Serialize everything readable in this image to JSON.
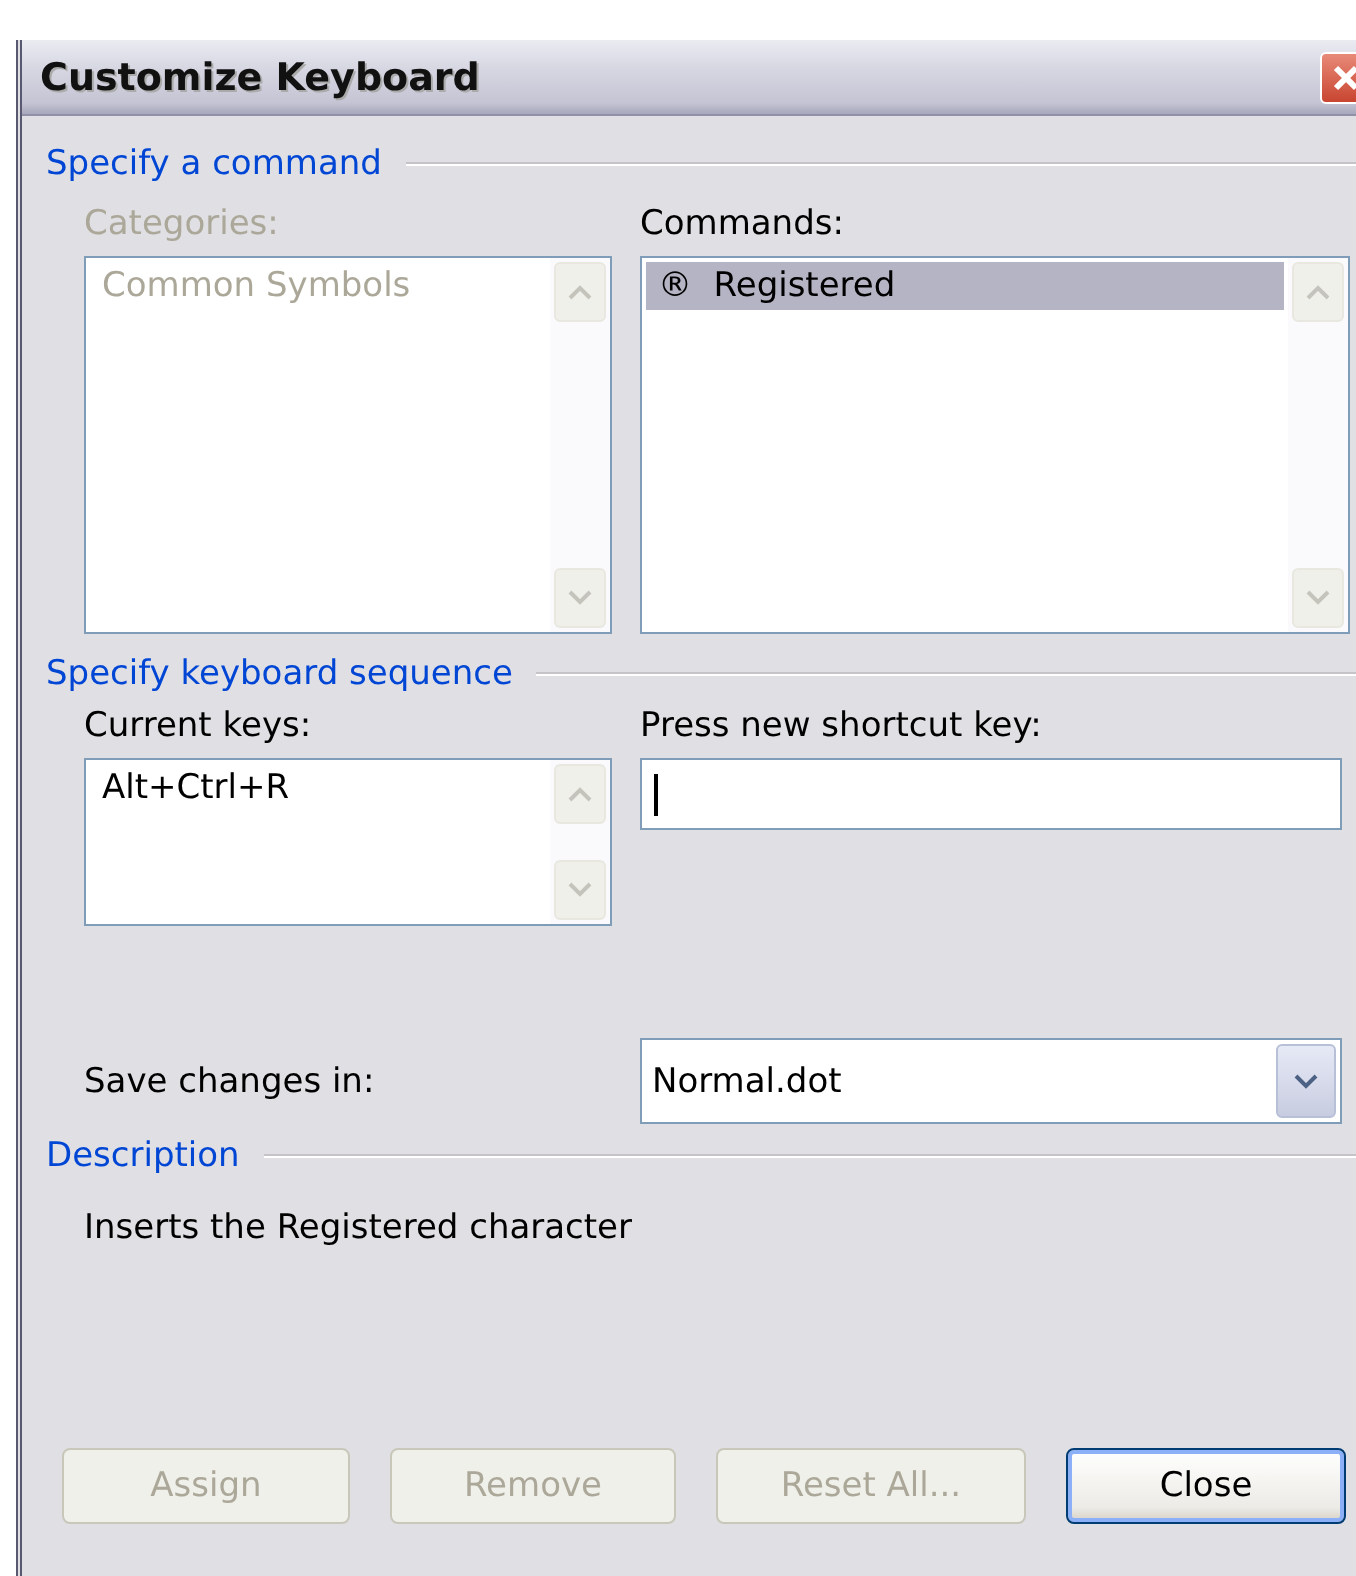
{
  "window": {
    "title": "Customize Keyboard"
  },
  "command_section": {
    "heading": "Specify a command",
    "categories": {
      "label": "Categories:",
      "disabled": true,
      "items": [
        {
          "text": "Common Symbols",
          "selected": false
        }
      ]
    },
    "commands": {
      "label": "Commands:",
      "disabled": false,
      "items": [
        {
          "text": "®  Registered",
          "selected": true
        }
      ]
    }
  },
  "keyboard_section": {
    "heading": "Specify keyboard sequence",
    "current_keys": {
      "label": "Current keys:",
      "disabled": false,
      "items": [
        {
          "text": "Alt+Ctrl+R",
          "selected": false
        }
      ]
    },
    "new_shortcut": {
      "label": "Press new shortcut key:",
      "focused": true
    }
  },
  "save_changes": {
    "label": "Save changes in:",
    "value": "Normal.dot"
  },
  "description": {
    "heading": "Description",
    "text": "Inserts the Registered character"
  },
  "buttons": [
    {
      "label": "Assign",
      "disabled": true,
      "default": false
    },
    {
      "label": "Remove",
      "disabled": true,
      "default": false
    },
    {
      "label": "Reset All...",
      "disabled": true,
      "default": false
    },
    {
      "label": "Close",
      "disabled": false,
      "default": true
    }
  ]
}
